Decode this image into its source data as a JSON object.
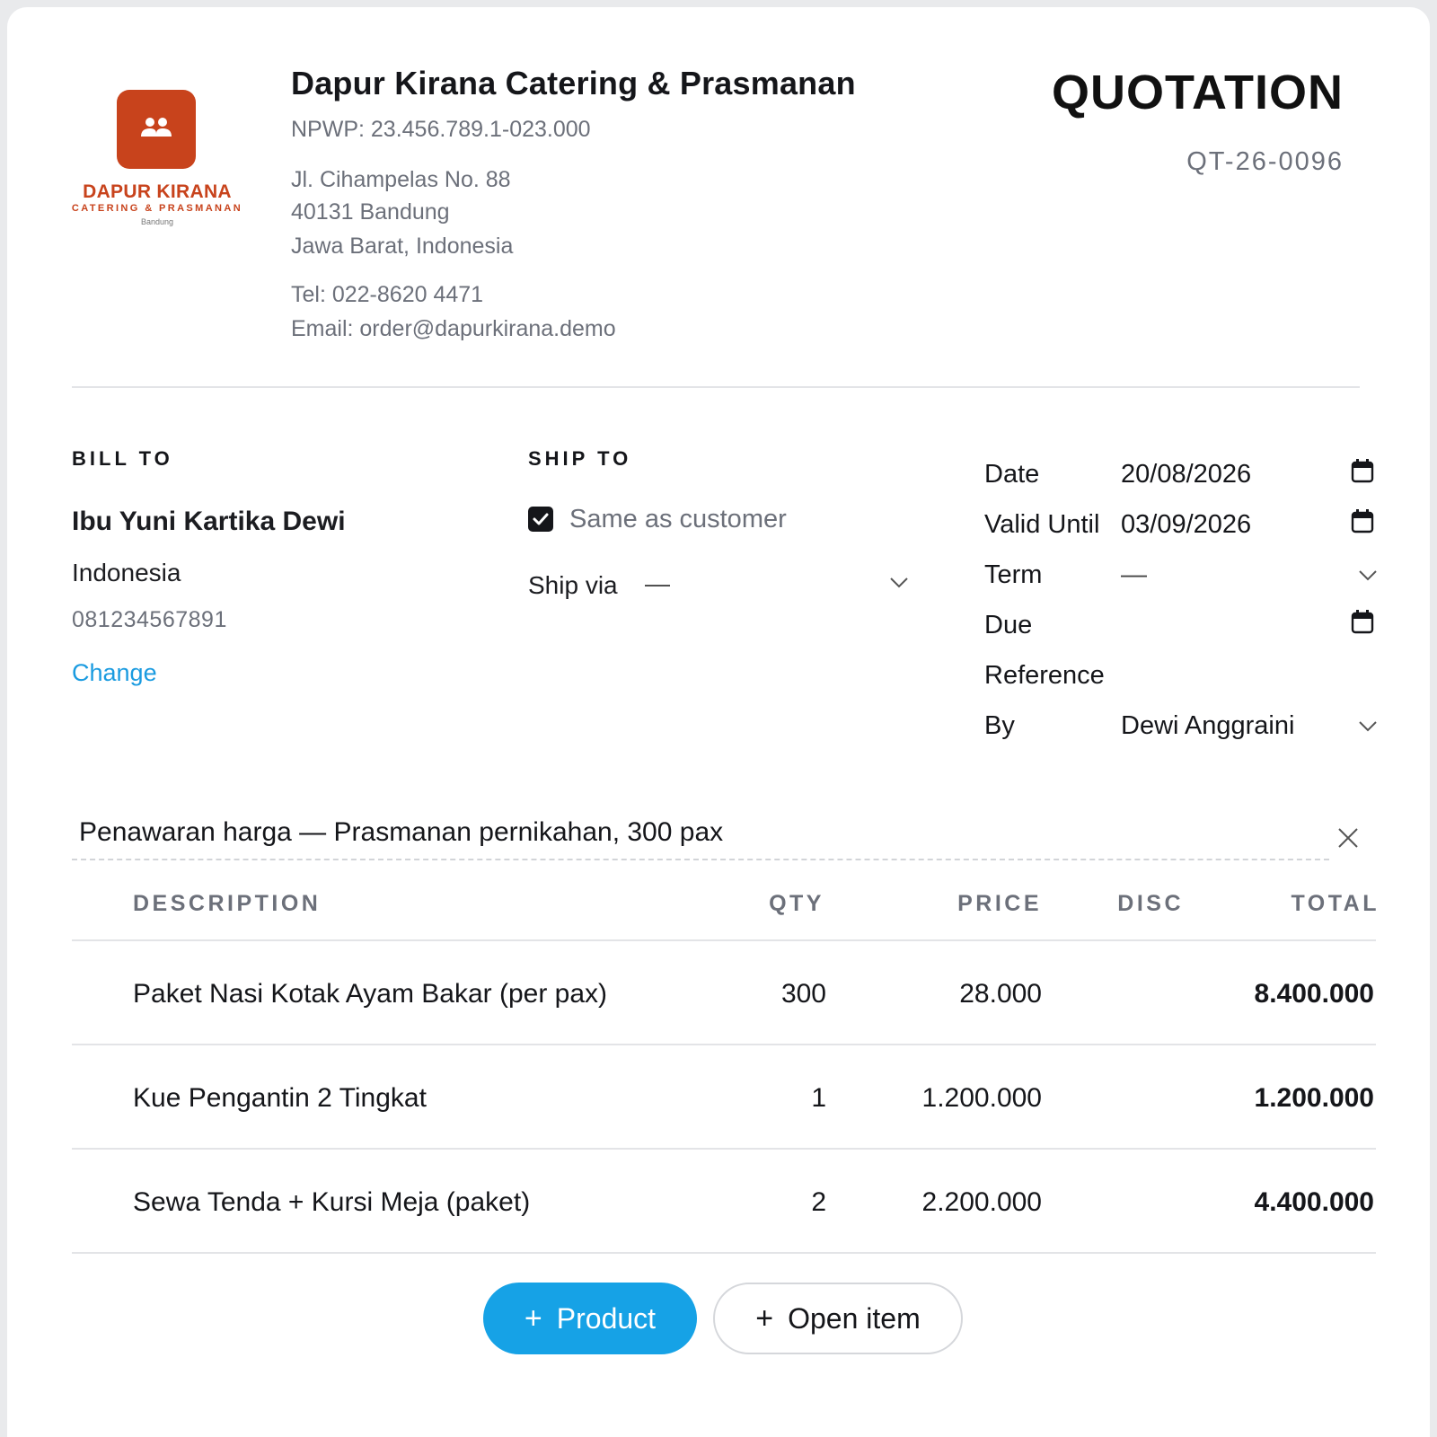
{
  "brand": {
    "logo_name": "DAPUR KIRANA",
    "logo_tagline": "CATERING & PRASMANAN",
    "logo_city": "Bandung",
    "accent_color": "#c8431c"
  },
  "company": {
    "name": "Dapur Kirana Catering & Prasmanan",
    "npwp": "NPWP: 23.456.789.1-023.000",
    "address_line1": "Jl. Cihampelas No. 88",
    "address_line2": "40131 Bandung",
    "address_line3": "Jawa Barat, Indonesia",
    "phone": "Tel: 022-8620 4471",
    "email": "Email: order@dapurkirana.demo"
  },
  "document": {
    "title": "QUOTATION",
    "number": "QT-26-0096"
  },
  "bill_to": {
    "label": "BILL TO",
    "name": "Ibu Yuni Kartika Dewi",
    "country": "Indonesia",
    "phone": "081234567891",
    "change_label": "Change"
  },
  "ship_to": {
    "label": "SHIP TO",
    "same_as_customer_label": "Same as customer",
    "same_as_customer_checked": true,
    "ship_via_label": "Ship via",
    "ship_via_value": "—"
  },
  "meta": {
    "date_label": "Date",
    "date_value": "20/08/2026",
    "valid_until_label": "Valid Until",
    "valid_until_value": "03/09/2026",
    "term_label": "Term",
    "term_value": "—",
    "due_label": "Due",
    "due_value": "",
    "reference_label": "Reference",
    "reference_value": "",
    "by_label": "By",
    "by_value": "Dewi Anggraini"
  },
  "note": {
    "text": "Penawaran harga — Prasmanan pernikahan, 300 pax"
  },
  "table": {
    "headers": {
      "description": "DESCRIPTION",
      "qty": "QTY",
      "price": "PRICE",
      "disc": "DISC",
      "total": "TOTAL"
    },
    "rows": [
      {
        "description": "Paket Nasi Kotak Ayam Bakar (per pax)",
        "qty": "300",
        "price": "28.000",
        "disc": "",
        "total": "8.400.000"
      },
      {
        "description": "Kue Pengantin 2 Tingkat",
        "qty": "1",
        "price": "1.200.000",
        "disc": "",
        "total": "1.200.000"
      },
      {
        "description": "Sewa Tenda + Kursi Meja (paket)",
        "qty": "2",
        "price": "2.200.000",
        "disc": "",
        "total": "4.400.000"
      }
    ]
  },
  "actions": {
    "add_product_label": "Product",
    "add_open_item_label": "Open item",
    "plus_glyph": "+"
  }
}
